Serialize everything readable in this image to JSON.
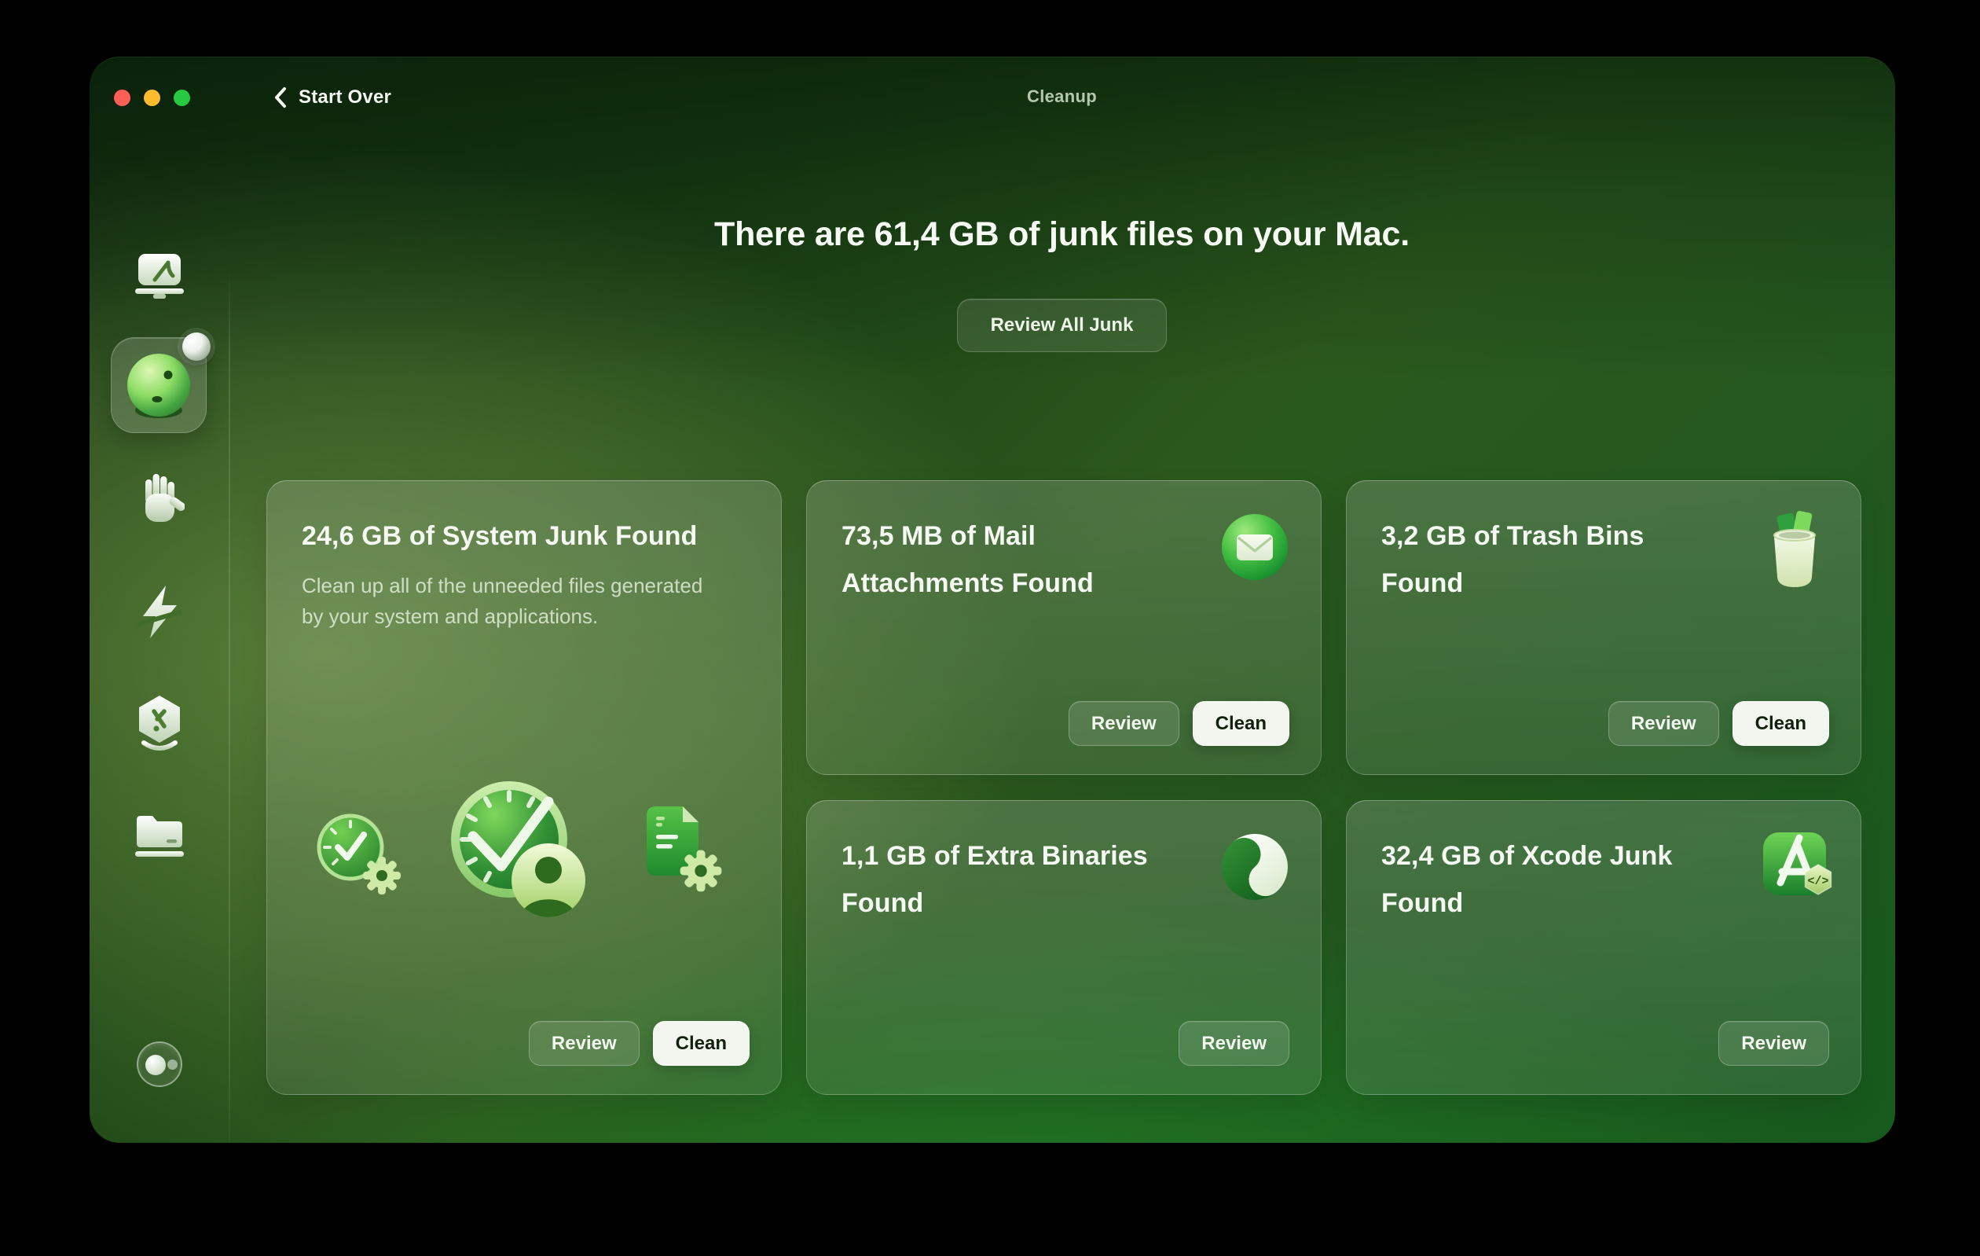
{
  "titlebar": {
    "back_label": "Start Over",
    "title": "Cleanup"
  },
  "hero": {
    "headline": "There are 61,4 GB of junk files on your Mac.",
    "review_all_label": "Review All Junk"
  },
  "sidebar": {
    "items": [
      {
        "name": "smart-care",
        "icon": "mac-display-icon",
        "active": false
      },
      {
        "name": "cleanup",
        "icon": "cleanup-sphere-icon",
        "active": true,
        "has_badge": true
      },
      {
        "name": "protection",
        "icon": "stop-hand-icon",
        "active": false
      },
      {
        "name": "performance",
        "icon": "lightning-icon",
        "active": false
      },
      {
        "name": "applications",
        "icon": "applications-hexagon-icon",
        "active": false
      },
      {
        "name": "my-clutter",
        "icon": "folder-icon",
        "active": false
      }
    ],
    "assistant_icon": "assistant-bubbles-icon"
  },
  "cards": [
    {
      "id": "system-junk",
      "title": "24,6 GB of System Junk Found",
      "description": "Clean up all of the unneeded files generated by your system and applications.",
      "icon": "clocks-user-document-gears-illustration",
      "review_label": "Review",
      "clean_label": "Clean"
    },
    {
      "id": "mail-attachments",
      "title": "73,5 MB of Mail Attachments Found",
      "icon": "mail-envelope-icon",
      "review_label": "Review",
      "clean_label": "Clean"
    },
    {
      "id": "trash-bins",
      "title": "3,2 GB of Trash Bins Found",
      "icon": "trash-bin-icon",
      "review_label": "Review",
      "clean_label": "Clean"
    },
    {
      "id": "extra-binaries",
      "title": "1,1 GB of Extra Binaries Found",
      "icon": "binaries-swirl-icon",
      "review_label": "Review"
    },
    {
      "id": "xcode-junk",
      "title": "32,4 GB of Xcode Junk Found",
      "icon": "xcode-tools-icon",
      "badge_glyph": "</>",
      "review_label": "Review"
    }
  ],
  "colors": {
    "traffic_red": "#ff5f57",
    "traffic_yellow": "#febc2e",
    "traffic_green": "#28c840",
    "window_dark_green": "#0d2c0e",
    "window_light_green": "#4e7733",
    "bottom_green": "#17591d",
    "clean_button_bg": "#f2f6ee",
    "clean_button_text": "#12200e",
    "titlebar_title_color": "#b5c7af"
  }
}
